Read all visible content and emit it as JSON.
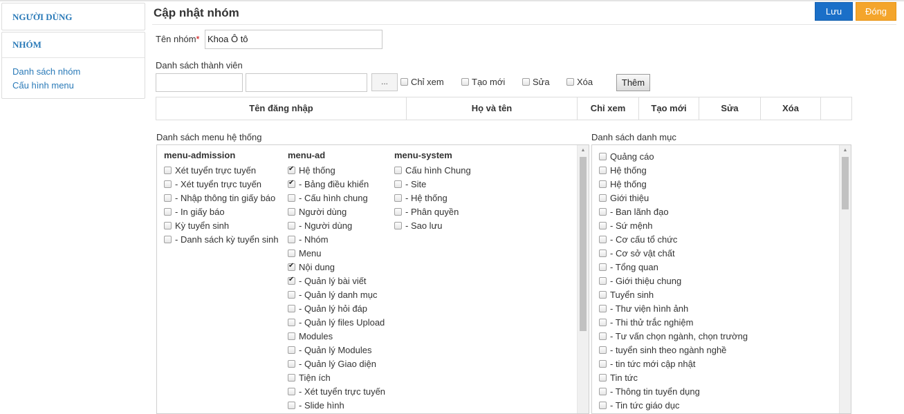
{
  "sidebar": {
    "users_heading": "NGƯỜI DÙNG",
    "groups_heading": "NHÓM",
    "links": [
      "Danh sách nhóm",
      "Cấu hình menu"
    ]
  },
  "header": {
    "title": "Cập nhật nhóm",
    "save": "Lưu",
    "close": "Đóng"
  },
  "form": {
    "group_name_label": "Tên nhóm",
    "required_mark": "*",
    "group_name_value": "Khoa Ô tô",
    "members_label": "Danh sách thành viên",
    "browse_button": "...",
    "perm_view": "Chỉ xem",
    "perm_create": "Tạo mới",
    "perm_edit": "Sửa",
    "perm_delete": "Xóa",
    "add_button": "Thêm"
  },
  "member_table": {
    "columns": [
      "Tên đăng nhập",
      "Họ và tên",
      "Chỉ xem",
      "Tạo mới",
      "Sửa",
      "Xóa",
      ""
    ]
  },
  "menu_panel": {
    "label": "Danh sách menu hệ thống",
    "columns": [
      {
        "heading": "menu-admission",
        "items": [
          {
            "label": "Xét tuyển trực tuyến",
            "checked": false
          },
          {
            "label": "- Xét tuyển trực tuyến",
            "checked": false
          },
          {
            "label": "- Nhập thông tin giấy báo",
            "checked": false
          },
          {
            "label": "- In giấy báo",
            "checked": false
          },
          {
            "label": "Kỳ tuyển sinh",
            "checked": false
          },
          {
            "label": "- Danh sách kỳ tuyển sinh",
            "checked": false
          }
        ]
      },
      {
        "heading": "menu-ad",
        "items": [
          {
            "label": "Hệ thống",
            "checked": true
          },
          {
            "label": "- Bảng điều khiển",
            "checked": true
          },
          {
            "label": "- Cấu hình chung",
            "checked": false
          },
          {
            "label": "Người dùng",
            "checked": false
          },
          {
            "label": "- Người dùng",
            "checked": false
          },
          {
            "label": "- Nhóm",
            "checked": false
          },
          {
            "label": "Menu",
            "checked": false
          },
          {
            "label": "Nội dung",
            "checked": true
          },
          {
            "label": "- Quản lý bài viết",
            "checked": true
          },
          {
            "label": "- Quản lý danh mục",
            "checked": false
          },
          {
            "label": "- Quản lý hỏi đáp",
            "checked": false
          },
          {
            "label": "- Quản lý files Upload",
            "checked": false
          },
          {
            "label": "Modules",
            "checked": false
          },
          {
            "label": "- Quản lý Modules",
            "checked": false
          },
          {
            "label": "- Quản lý Giao diện",
            "checked": false
          },
          {
            "label": "Tiện ích",
            "checked": false
          },
          {
            "label": "- Xét tuyển trực tuyến",
            "checked": false
          },
          {
            "label": "- Slide hình",
            "checked": false
          }
        ]
      },
      {
        "heading": "menu-system",
        "items": [
          {
            "label": "Cấu hình Chung",
            "checked": false
          },
          {
            "label": "- Site",
            "checked": false
          },
          {
            "label": "- Hệ thống",
            "checked": false
          },
          {
            "label": "- Phân quyền",
            "checked": false
          },
          {
            "label": "- Sao lưu",
            "checked": false
          }
        ]
      }
    ]
  },
  "category_panel": {
    "label": "Danh sách danh mục",
    "items": [
      {
        "label": "Quảng cáo",
        "checked": false
      },
      {
        "label": "Hệ thống",
        "checked": false
      },
      {
        "label": "Hệ thống",
        "checked": false
      },
      {
        "label": "Giới thiệu",
        "checked": false
      },
      {
        "label": "- Ban lãnh đạo",
        "checked": false
      },
      {
        "label": "- Sứ mệnh",
        "checked": false
      },
      {
        "label": "- Cơ cấu tổ chức",
        "checked": false
      },
      {
        "label": "- Cơ sở vật chất",
        "checked": false
      },
      {
        "label": "- Tổng quan",
        "checked": false
      },
      {
        "label": "- Giới thiệu chung",
        "checked": false
      },
      {
        "label": "Tuyển sinh",
        "checked": false
      },
      {
        "label": "- Thư viện hình ảnh",
        "checked": false
      },
      {
        "label": "- Thi thử trắc nghiệm",
        "checked": false
      },
      {
        "label": "- Tư vấn chọn ngành, chọn trường",
        "checked": false
      },
      {
        "label": "- tuyển sinh theo ngành nghề",
        "checked": false
      },
      {
        "label": "- tin tức mới cập nhật",
        "checked": false
      },
      {
        "label": "Tin tức",
        "checked": false
      },
      {
        "label": "- Thông tin tuyển dụng",
        "checked": false
      },
      {
        "label": "- Tin tức giáo dục",
        "checked": false
      }
    ]
  }
}
